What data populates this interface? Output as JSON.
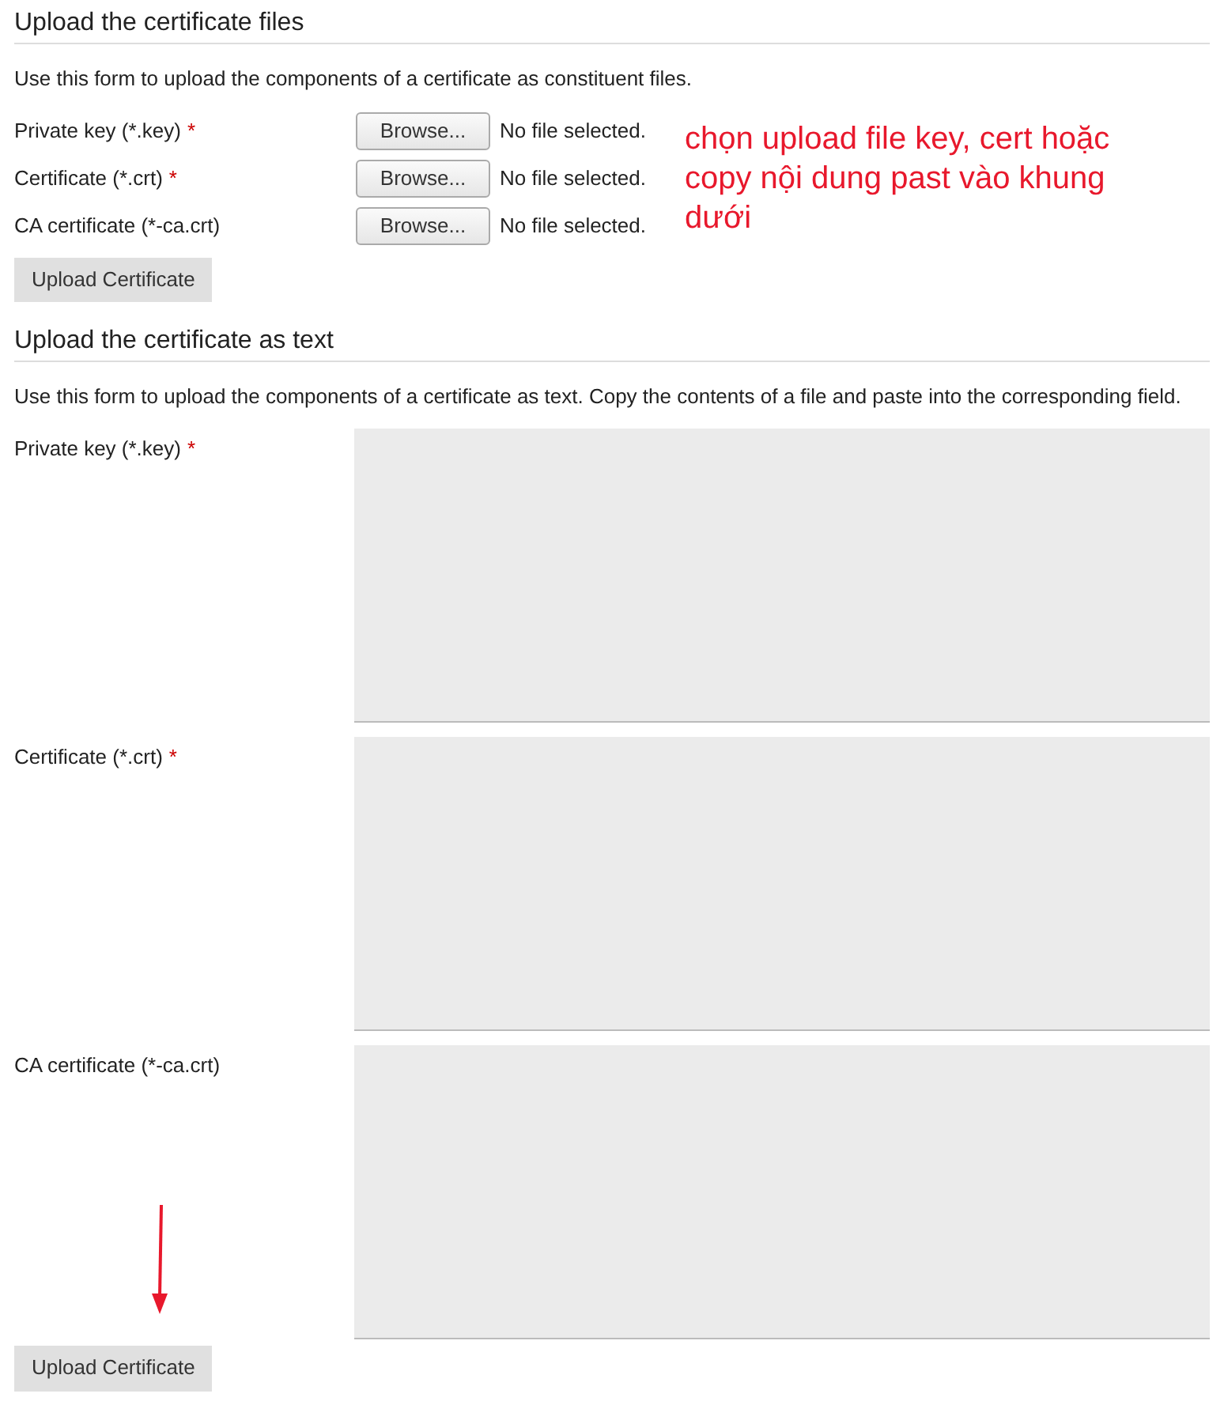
{
  "file_section": {
    "heading": "Upload the certificate files",
    "description": "Use this form to upload the components of a certificate as constituent files.",
    "fields": [
      {
        "label": "Private key (*.key)",
        "required_mark": "*",
        "button": "Browse...",
        "status": "No file selected."
      },
      {
        "label": "Certificate (*.crt)",
        "required_mark": "*",
        "button": "Browse...",
        "status": "No file selected."
      },
      {
        "label": "CA certificate (*-ca.crt)",
        "button": "Browse...",
        "status": "No file selected."
      }
    ],
    "submit": "Upload Certificate"
  },
  "annotation": "chọn upload file key, cert hoặc copy nội dung past vào khung dưới",
  "text_section": {
    "heading": "Upload the certificate as text",
    "description": "Use this form to upload the components of a certificate as text. Copy the contents of a file and paste into the corresponding field.",
    "fields": [
      {
        "label": "Private key (*.key)",
        "required_mark": "*"
      },
      {
        "label": "Certificate (*.crt)",
        "required_mark": "*"
      },
      {
        "label": "CA certificate (*-ca.crt)"
      }
    ],
    "submit": "Upload Certificate"
  }
}
